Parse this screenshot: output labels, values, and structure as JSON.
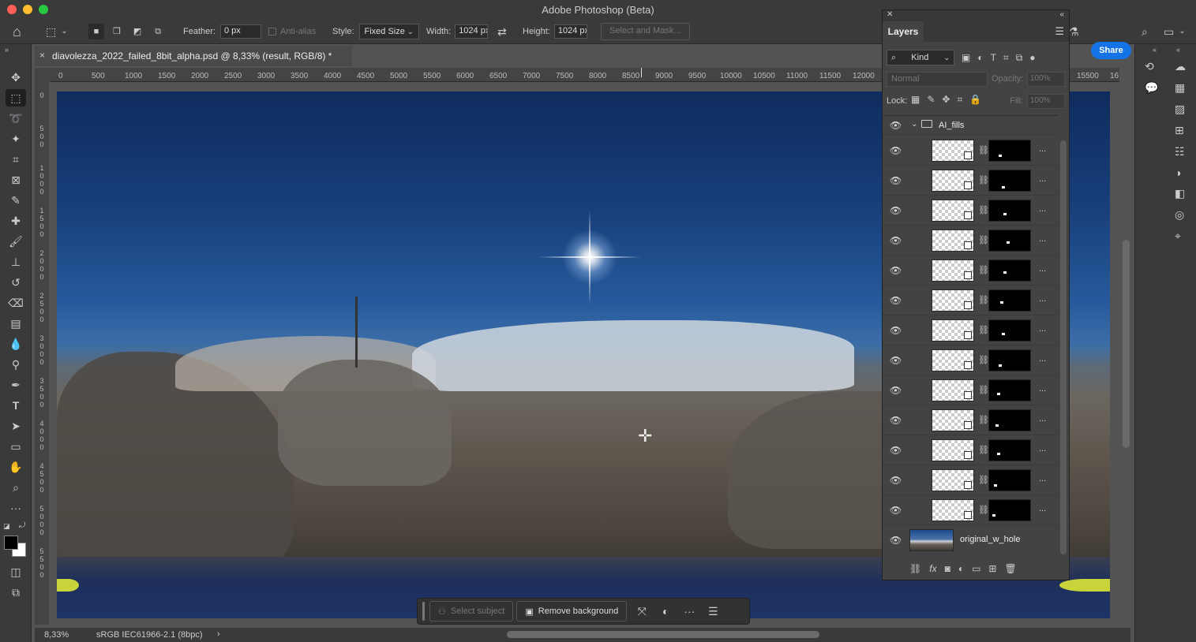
{
  "window": {
    "title": "Adobe Photoshop (Beta)"
  },
  "options_bar": {
    "feather_label": "Feather:",
    "feather_value": "0 px",
    "anti_alias_label": "Anti-alias",
    "style_label": "Style:",
    "style_value": "Fixed Size",
    "width_label": "Width:",
    "width_value": "1024 px",
    "height_label": "Height:",
    "height_value": "1024 px",
    "select_mask_label": "Select and Mask...",
    "share_label": "Share"
  },
  "document": {
    "tab_title": "diavolezza_2022_failed_8bit_alpha.psd @ 8,33% (result, RGB/8) *",
    "close_glyph": "×"
  },
  "ruler": {
    "h_ticks": [
      "0",
      "500",
      "1000",
      "1500",
      "2000",
      "2500",
      "3000",
      "3500",
      "4000",
      "4500",
      "5000",
      "5500",
      "6000",
      "6500",
      "7000",
      "7500",
      "8000",
      "8500",
      "9000",
      "9500",
      "10000",
      "10500",
      "11000",
      "11500",
      "12000",
      "15500",
      "16"
    ],
    "v_labels": [
      "0",
      "500",
      "1000",
      "1500",
      "2000",
      "2500",
      "3000",
      "3500",
      "4000",
      "4500",
      "5000",
      "5500"
    ]
  },
  "task_bar": {
    "select_subject": "Select subject",
    "remove_background": "Remove background"
  },
  "status_bar": {
    "zoom": "8,33%",
    "profile": "sRGB IEC61966-2.1 (8bpc)",
    "arrow": "›"
  },
  "layers_panel": {
    "tab": "Layers",
    "kind_label": "Kind",
    "blend_mode": "Normal",
    "opacity_label": "Opacity:",
    "opacity_value": "100%",
    "lock_label": "Lock:",
    "fill_label": "Fill:",
    "fill_value": "100%",
    "group_name": "AI_fills",
    "layer_count": 13,
    "more_glyph": "...",
    "original_layer_name": "original_w_hole"
  },
  "icons": {
    "eye": "👁",
    "link": "⛓",
    "chevron_down": "⌄"
  }
}
